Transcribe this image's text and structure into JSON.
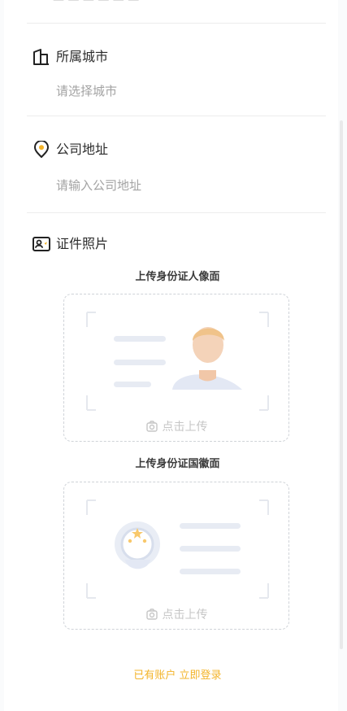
{
  "fields": [
    {
      "title": "所属城市",
      "value": "请选择城市",
      "icon": "building-icon"
    },
    {
      "title": "公司地址",
      "value": "请输入公司地址",
      "icon": "location-pin-icon"
    }
  ],
  "photo_section": {
    "title": "证件照片",
    "icon": "id-card-icon",
    "front": {
      "subtitle": "上传身份证人像面",
      "hint": "点击上传"
    },
    "back": {
      "subtitle": "上传身份证国徽面",
      "hint": "点击上传"
    }
  },
  "footer": {
    "login_text": "已有账户 立即登录"
  },
  "colors": {
    "accent": "#f3b42b",
    "placeholder": "#a3a3a3",
    "divider": "#ededed"
  }
}
